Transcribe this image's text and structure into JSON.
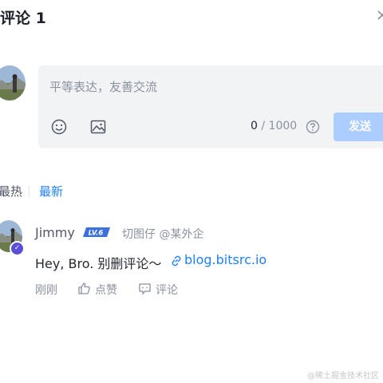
{
  "header": {
    "title": "评论 1",
    "close_icon": "close-icon"
  },
  "editor": {
    "placeholder": "平等表达，友善交流",
    "emoji_icon": "emoji-icon",
    "image_icon": "image-icon",
    "count_current": "0",
    "count_sep": " / ",
    "count_max": "1000",
    "help_icon": "question-circle-icon",
    "send_label": "发送"
  },
  "sort_tabs": {
    "hot": "最热",
    "new": "最新",
    "active_color": "#1e80ff"
  },
  "comment": {
    "username": "Jimmy",
    "level": "LV.6",
    "job": "切图仔 @某外企",
    "text": "Hey, Bro. 别删评论～",
    "link_text": "blog.bitsrc.io",
    "time": "刚刚",
    "like_label": "点赞",
    "comment_label": "评论",
    "more": "⋮"
  },
  "watermark": "@稀土掘金技术社区",
  "colors": {
    "accent": "#1e80ff",
    "send_disabled": "#abcdff",
    "editor_bg": "#f2f3f5",
    "muted": "#8a919f"
  }
}
